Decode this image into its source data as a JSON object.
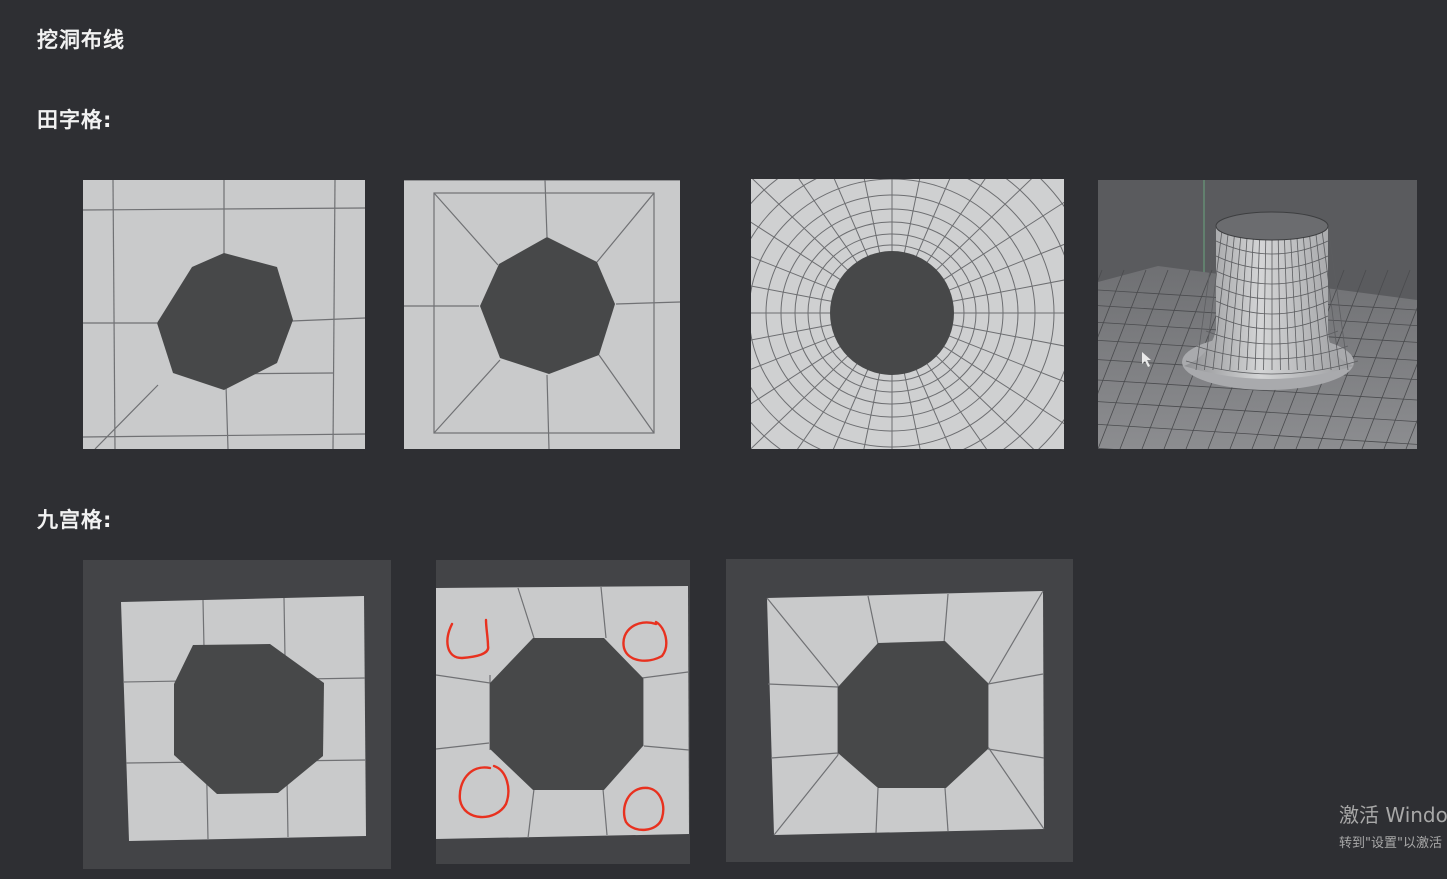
{
  "page": {
    "title": "挖洞布线",
    "sections": [
      {
        "heading": "田字格:"
      },
      {
        "heading": "九宫格:"
      }
    ]
  },
  "colors": {
    "background": "#2e2f33",
    "mesh_surface": "#c9cacb",
    "hole": "#474849",
    "wire": "#6e6f72",
    "annotation": "#e8311f"
  },
  "watermark": {
    "line1": "激活 Windo",
    "line2": "转到\"设置\"以激活"
  }
}
